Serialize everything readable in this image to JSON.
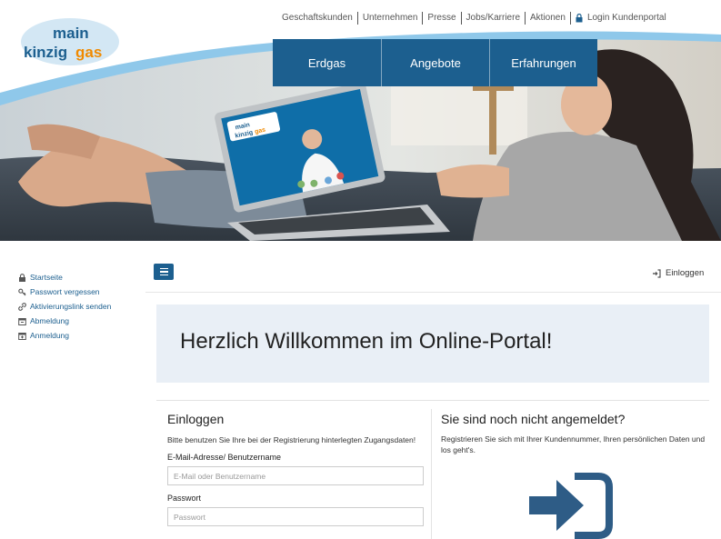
{
  "header": {
    "logo_line1": "main",
    "logo_line2a": "kinzig",
    "logo_line2b": "gas",
    "top_nav": [
      "Geschaftskunden",
      "Unternehmen",
      "Presse",
      "Jobs/Karriere",
      "Aktionen"
    ],
    "portal_link": "Login Kundenportal",
    "main_nav": [
      "Erdgas",
      "Angebote",
      "Erfahrungen"
    ]
  },
  "sidebar": {
    "items": [
      {
        "label": "Startseite",
        "icon": "lock-icon"
      },
      {
        "label": "Passwort vergessen",
        "icon": "key-icon"
      },
      {
        "label": "Aktivierungslink senden",
        "icon": "link-icon"
      },
      {
        "label": "Abmeldung",
        "icon": "calendar-icon"
      },
      {
        "label": "Anmeldung",
        "icon": "calendar-icon"
      }
    ]
  },
  "toolbar": {
    "menu_icon": "hamburger-icon",
    "login_label": "Einloggen",
    "login_icon": "sign-in-icon"
  },
  "welcome": {
    "title": "Herzlich Willkommen im Online-Portal!"
  },
  "login": {
    "heading": "Einloggen",
    "intro": "Bitte benutzen Sie Ihre bei der Registrierung hinterlegten Zugangsdaten!",
    "email_label": "E-Mail-Adresse/ Benutzername",
    "email_placeholder": "E-Mail oder Benutzername",
    "email_value": "",
    "password_label": "Passwort",
    "password_placeholder": "Passwort",
    "password_value": ""
  },
  "register": {
    "heading": "Sie sind noch nicht angemeldet?",
    "intro": "Registrieren Sie sich mit Ihrer Kundennummer, Ihren persönlichen Daten und los geht's.",
    "icon": "sign-in-arrow-icon"
  },
  "colors": {
    "brand_blue": "#1c5f8f",
    "welcome_bg": "#e9eff6",
    "logo_orange": "#f08a00"
  }
}
